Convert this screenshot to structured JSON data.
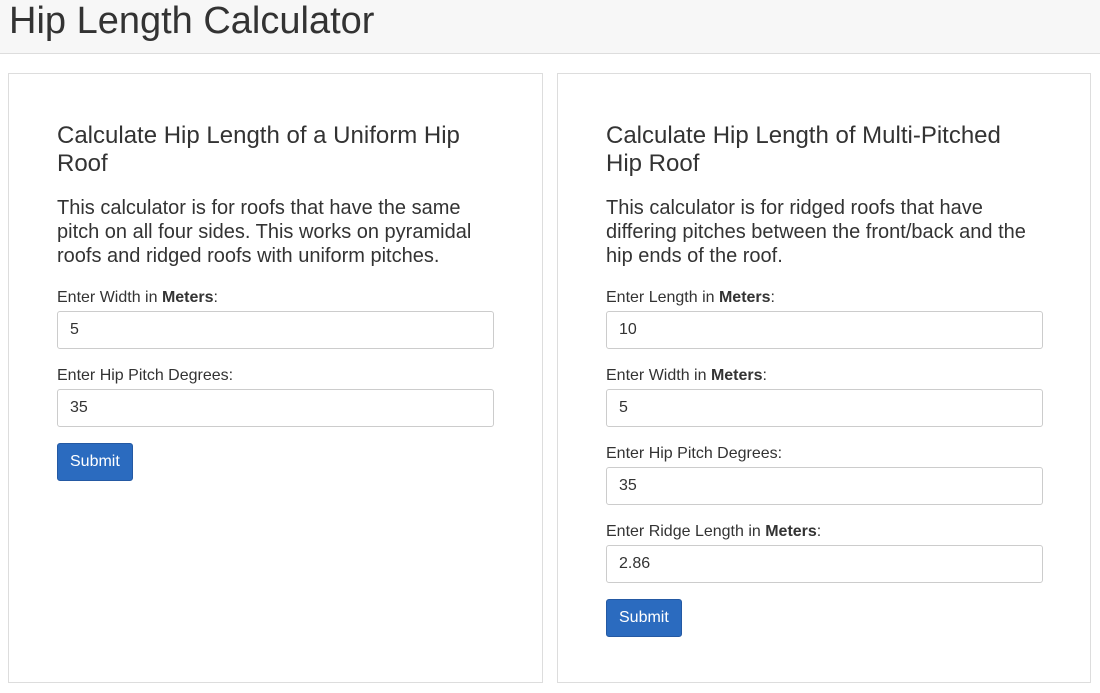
{
  "page": {
    "title": "Hip Length Calculator"
  },
  "uniform_form": {
    "heading": "Calculate Hip Length of a Uniform Hip Roof",
    "description": "This calculator is for roofs that have the same pitch on all four sides. This works on pyramidal roofs and ridged roofs with uniform pitches.",
    "width_label_prefix": "Enter Width in ",
    "width_label_unit": "Meters",
    "width_label_suffix": ":",
    "width_value": "5",
    "pitch_label": "Enter Hip Pitch Degrees:",
    "pitch_value": "35",
    "submit_label": "Submit"
  },
  "multi_form": {
    "heading": "Calculate Hip Length of Multi-Pitched Hip Roof",
    "description": "This calculator is for ridged roofs that have differing pitches between the front/back and the hip ends of the roof.",
    "length_label_prefix": "Enter Length in ",
    "length_label_unit": "Meters",
    "length_label_suffix": ":",
    "length_value": "10",
    "width_label_prefix": "Enter Width in ",
    "width_label_unit": "Meters",
    "width_label_suffix": ":",
    "width_value": "5",
    "pitch_label": "Enter Hip Pitch Degrees:",
    "pitch_value": "35",
    "ridge_label_prefix": "Enter Ridge Length in ",
    "ridge_label_unit": "Meters",
    "ridge_label_suffix": ":",
    "ridge_value": "2.86",
    "submit_label": "Submit"
  },
  "colors": {
    "primary_button": "#2b6bbf",
    "header_background": "#f7f7f7"
  }
}
